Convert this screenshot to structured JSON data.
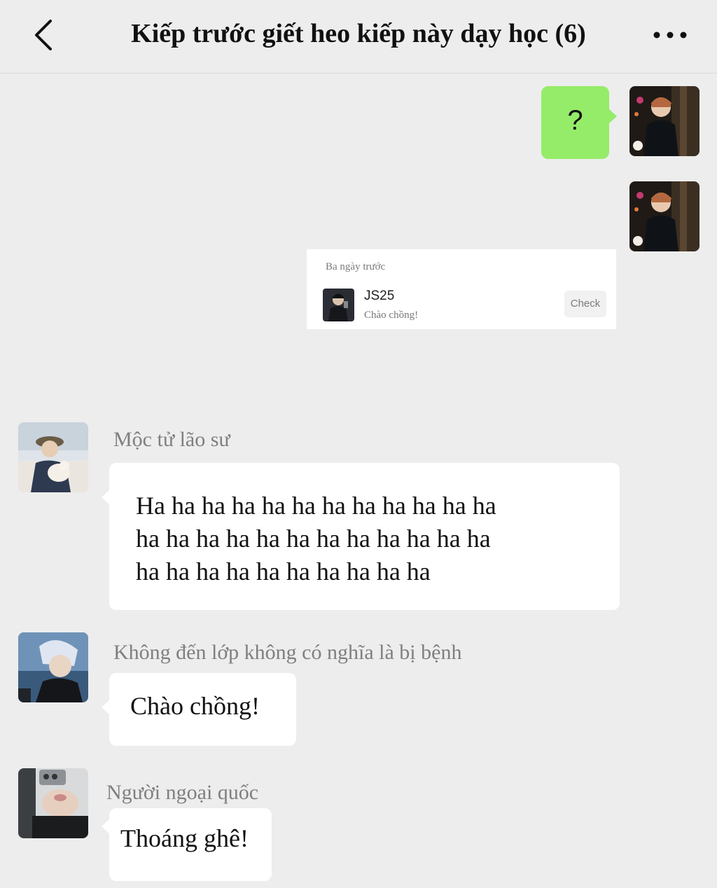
{
  "header": {
    "title": "Kiếp trước giết heo kiếp này dạy học (6)",
    "back_icon": "chevron-left-icon",
    "more_icon": "more-dots-icon"
  },
  "colors": {
    "background": "#ededed",
    "own_bubble": "#95ec69",
    "other_bubble": "#ffffff",
    "sender_name": "#7f7f7f"
  },
  "messages": [
    {
      "from": "self",
      "text": "?"
    },
    {
      "from": "self",
      "card": {
        "time": "Ba ngày trước",
        "name": "JS25",
        "preview": "Chào chồng!",
        "button": "Check"
      }
    },
    {
      "from": "other",
      "sender": "Mộc tử lão sư",
      "lines": [
        "Ha ha ha ha ha ha ha ha ha ha ha ha",
        "ha ha ha ha ha ha ha ha ha ha ha ha",
        "ha ha ha ha ha ha ha ha ha ha"
      ]
    },
    {
      "from": "other",
      "sender": "Không đến lớp không có nghĩa là bị bệnh",
      "text": "Chào chồng!"
    },
    {
      "from": "other",
      "sender": "Người ngoại quốc",
      "text": "Thoáng ghê!"
    }
  ]
}
